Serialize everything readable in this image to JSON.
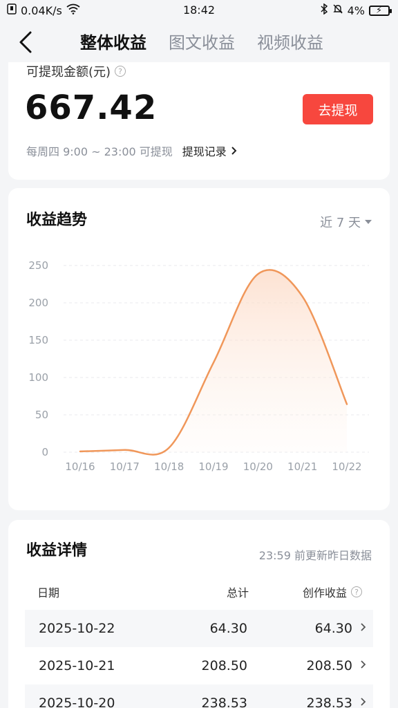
{
  "status_bar": {
    "net_speed": "0.04K/s",
    "time": "18:42",
    "battery": "4%"
  },
  "nav": {
    "tabs": [
      {
        "label": "整体收益",
        "active": true
      },
      {
        "label": "图文收益",
        "active": false
      },
      {
        "label": "视频收益",
        "active": false
      }
    ]
  },
  "withdraw": {
    "label": "可提现金额(元)",
    "amount": "667.42",
    "button": "去提现",
    "note": "每周四 9:00 ~ 23:00 可提现",
    "record_link": "提现记录"
  },
  "trend": {
    "title": "收益趋势",
    "range": "近 7 天"
  },
  "chart_data": {
    "type": "area",
    "categories": [
      "10/16",
      "10/17",
      "10/18",
      "10/19",
      "10/20",
      "10/21",
      "10/22"
    ],
    "values": [
      1,
      3,
      6,
      120,
      238.53,
      208.5,
      64.3
    ],
    "ylim": [
      0,
      250
    ],
    "yticks": [
      0,
      50,
      100,
      150,
      200,
      250
    ],
    "grid": true,
    "line_color": "#f0975a",
    "fill_color": "#fde5d6"
  },
  "detail": {
    "title": "收益详情",
    "update_note": "23:59 前更新昨日数据",
    "columns": [
      "日期",
      "总计",
      "创作收益"
    ],
    "rows": [
      {
        "date": "2025-10-22",
        "total": "64.30",
        "creation": "64.30"
      },
      {
        "date": "2025-10-21",
        "total": "208.50",
        "creation": "208.50"
      },
      {
        "date": "2025-10-20",
        "total": "238.53",
        "creation": "238.53"
      }
    ]
  },
  "colors": {
    "accent_red": "#f7473e",
    "muted_text": "#8a8f99"
  }
}
